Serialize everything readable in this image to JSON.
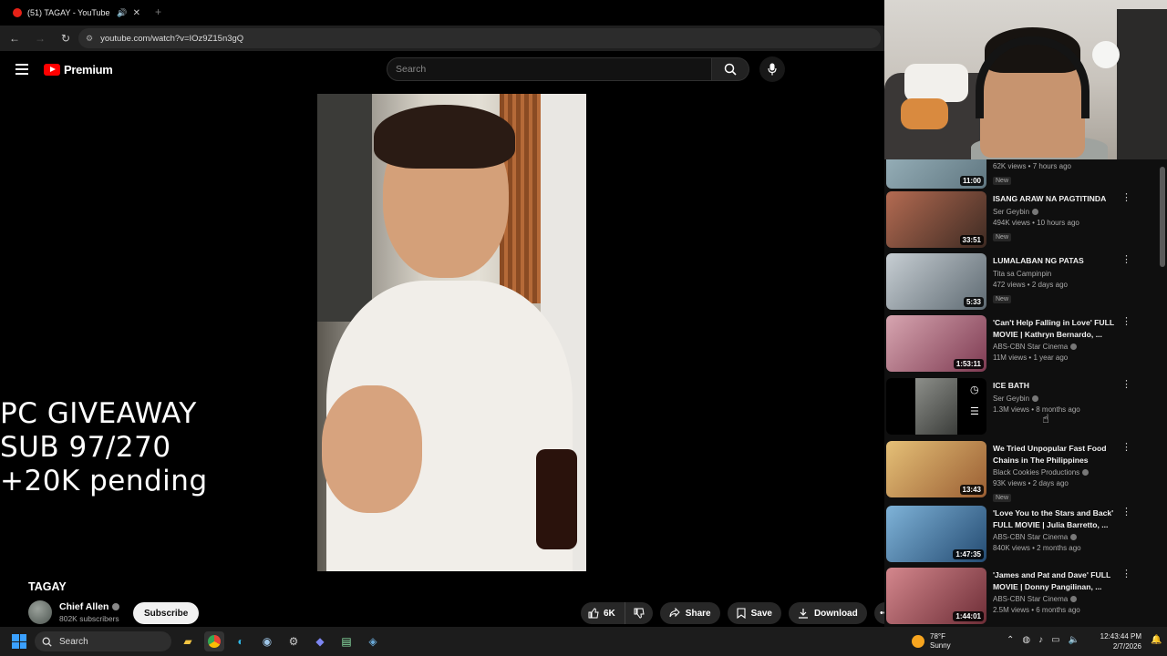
{
  "browser": {
    "tab_title": "(51) TAGAY - YouTube",
    "url": "youtube.com/watch?v=IOz9Z15n3gQ"
  },
  "youtube": {
    "logo_text": "Premium",
    "search_placeholder": "Search"
  },
  "video": {
    "overlay_lines": [
      "PC GIVEAWAY",
      "SUB 97/270",
      "+20K pending"
    ],
    "title": "TAGAY",
    "channel_name": "Chief Allen",
    "subscribers": "802K subscribers",
    "subscribe_label": "Subscribe",
    "like_count": "6K",
    "share_label": "Share",
    "save_label": "Save",
    "download_label": "Download"
  },
  "recommendations": [
    {
      "title": "",
      "channel": "",
      "stats": "62K views • 7 hours ago",
      "duration": "11:00",
      "badge": "New",
      "thumb": "#6f8a95"
    },
    {
      "title": "ISANG ARAW NA PAGTITINDA",
      "channel": "Ser Geybin",
      "stats": "494K views • 10 hours ago",
      "duration": "33:51",
      "badge": "New",
      "thumb": "#7a5a4a"
    },
    {
      "title": "LUMALABAN NG PATAS",
      "channel": "Tita sa Campinpin",
      "stats": "472 views • 2 days ago",
      "duration": "5:33",
      "badge": "New",
      "thumb": "#8e9aa3"
    },
    {
      "title": "'Can't Help Falling in Love' FULL MOVIE | Kathryn Bernardo, ...",
      "channel": "ABS-CBN Star Cinema",
      "stats": "11M views • 1 year ago",
      "duration": "1:53:11",
      "badge": "",
      "thumb": "#b07b86"
    },
    {
      "title": "ICE BATH",
      "channel": "Ser Geybin",
      "stats": "1.3M views • 8 months ago",
      "duration": "",
      "badge": "",
      "thumb": "#4a4a4a"
    },
    {
      "title": "We Tried Unpopular Fast Food Chains in The Philippines",
      "channel": "Black Cookies Productions",
      "stats": "93K views • 2 days ago",
      "duration": "13:43",
      "badge": "New",
      "thumb": "#c89a50"
    },
    {
      "title": "'Love You to the Stars and Back' FULL MOVIE | Julia Barretto, ...",
      "channel": "ABS-CBN Star Cinema",
      "stats": "840K views • 2 months ago",
      "duration": "1:47:35",
      "badge": "",
      "thumb": "#3d6f9e"
    },
    {
      "title": "'James and Pat and Dave' FULL MOVIE | Donny Pangilinan, ...",
      "channel": "ABS-CBN Star Cinema",
      "stats": "2.5M views • 6 months ago",
      "duration": "1:44:01",
      "badge": "",
      "thumb": "#a3585e"
    }
  ],
  "taskbar": {
    "search_label": "Search",
    "temperature": "78°F",
    "condition": "Sunny",
    "time": "12:43:44 PM",
    "date": "2/7/2026"
  }
}
